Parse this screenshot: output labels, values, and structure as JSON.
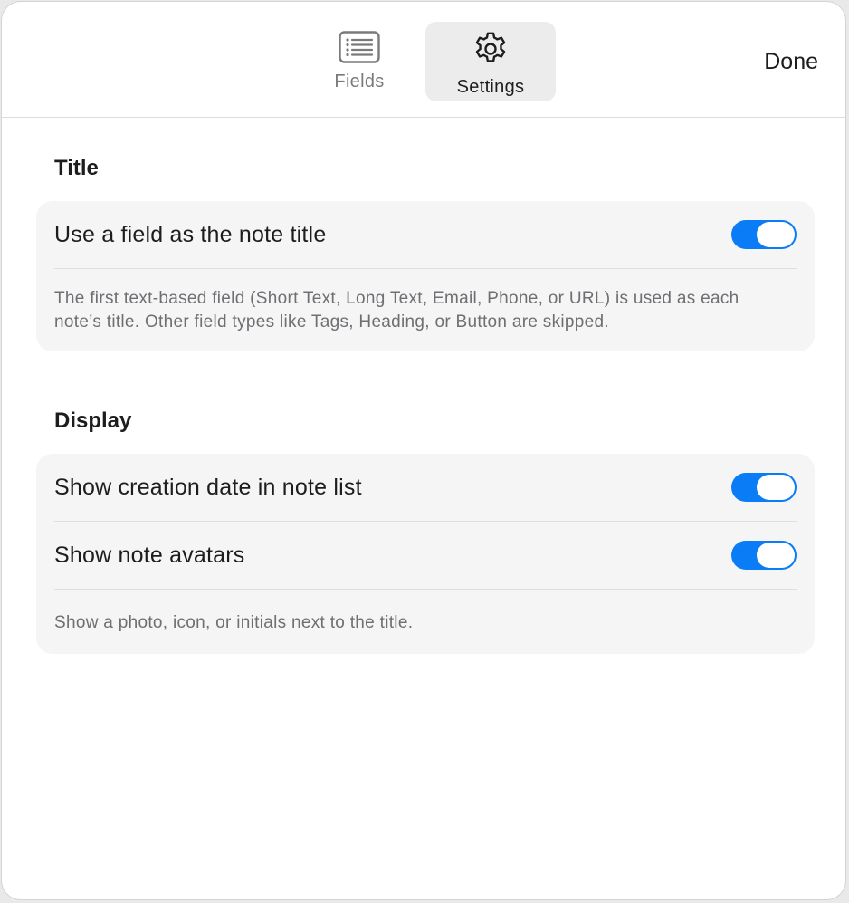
{
  "toolbar": {
    "tabs": [
      {
        "label": "Fields",
        "icon": "list-icon",
        "selected": false
      },
      {
        "label": "Settings",
        "icon": "gear-icon",
        "selected": true
      }
    ],
    "done_label": "Done"
  },
  "sections": {
    "title": {
      "heading": "Title",
      "rows": [
        {
          "label": "Use a field as the note title",
          "enabled": true
        }
      ],
      "footnote": "The first text-based field (Short Text, Long Text, Email, Phone, or URL) is used as each note’s title. Other field types like Tags, Heading, or Button are skipped."
    },
    "display": {
      "heading": "Display",
      "rows": [
        {
          "label": "Show creation date in note list",
          "enabled": true
        },
        {
          "label": "Show note avatars",
          "enabled": true
        }
      ],
      "footnote": "Show a photo, icon, or initials next to the title."
    }
  },
  "colors": {
    "accent": "#0a7cf6",
    "card_background": "#f5f5f5",
    "selected_tab_background": "#ececec"
  }
}
